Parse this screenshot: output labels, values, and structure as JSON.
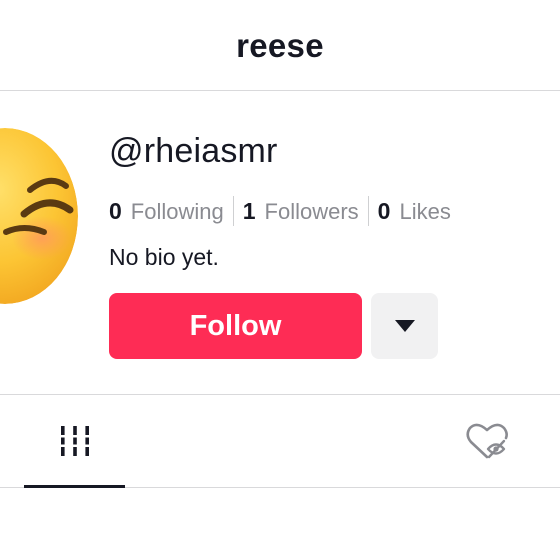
{
  "header": {
    "title": "reese"
  },
  "profile": {
    "avatar_icon": "smiling-emoji-avatar",
    "username": "@rheiasmr",
    "stats": [
      {
        "value": "0",
        "label": "Following"
      },
      {
        "value": "1",
        "label": "Followers"
      },
      {
        "value": "0",
        "label": "Likes"
      }
    ],
    "bio": "No bio yet.",
    "follow_label": "Follow",
    "more_icon": "caret-down-icon"
  },
  "tabs": {
    "active": "videos",
    "items": [
      {
        "name": "videos",
        "icon": "video-grid-icon"
      },
      {
        "name": "liked",
        "icon": "hidden-heart-icon"
      }
    ]
  },
  "colors": {
    "accent": "#fe2c55",
    "text": "#161823",
    "muted": "#8a8b91",
    "divider": "#d9d9db",
    "secondary_button": "#f1f1f2"
  }
}
